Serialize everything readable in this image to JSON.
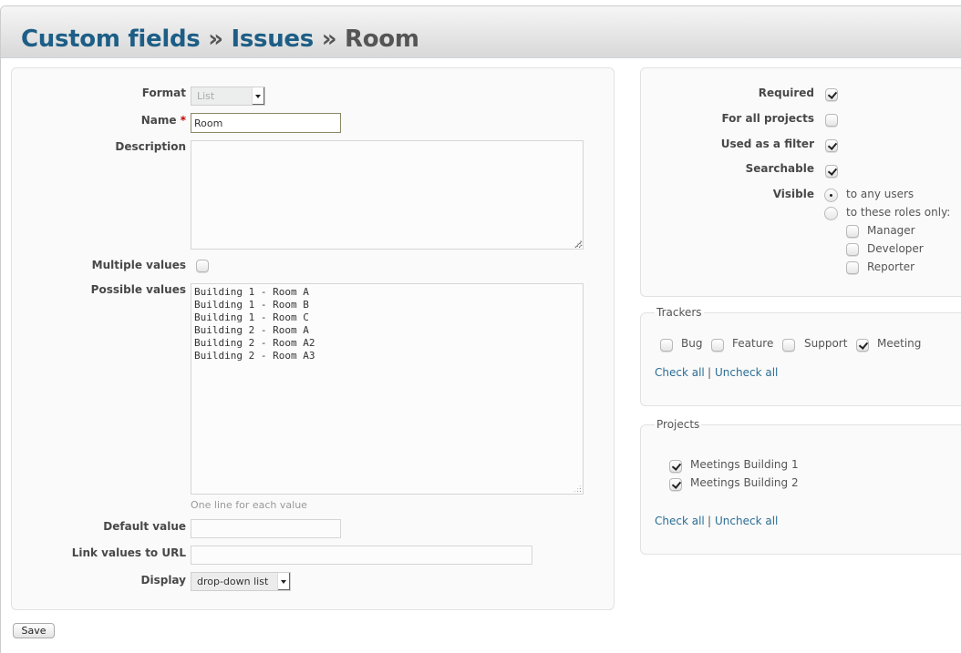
{
  "header": {
    "breadcrumb": [
      {
        "label": "Custom fields"
      },
      {
        "label": "Issues"
      }
    ],
    "separator": "»",
    "current": "Room"
  },
  "form": {
    "format": {
      "label": "Format",
      "value": "List"
    },
    "name": {
      "label": "Name",
      "required_mark": "*",
      "value": "Room"
    },
    "description": {
      "label": "Description",
      "value": ""
    },
    "multiple_values": {
      "label": "Multiple values",
      "checked": false
    },
    "possible_values": {
      "label": "Possible values",
      "value": "Building 1 - Room A\nBuilding 1 - Room B\nBuilding 1 - Room C\nBuilding 2 - Room A\nBuilding 2 - Room A2\nBuilding 2 - Room A3",
      "hint": "One line for each value"
    },
    "default_value": {
      "label": "Default value",
      "value": ""
    },
    "link_url": {
      "label": "Link values to URL",
      "value": ""
    },
    "display": {
      "label": "Display",
      "value": "drop-down list"
    }
  },
  "options": {
    "required": {
      "label": "Required",
      "checked": true
    },
    "for_all_projects": {
      "label": "For all projects",
      "checked": false
    },
    "used_as_filter": {
      "label": "Used as a filter",
      "checked": true
    },
    "searchable": {
      "label": "Searchable",
      "checked": true
    },
    "visible": {
      "label": "Visible",
      "any_users": "to any users",
      "these_roles": "to these roles only:",
      "selected": "any_users",
      "roles": [
        {
          "label": "Manager",
          "checked": false
        },
        {
          "label": "Developer",
          "checked": false
        },
        {
          "label": "Reporter",
          "checked": false
        }
      ]
    }
  },
  "trackers": {
    "legend": "Trackers",
    "items": [
      {
        "label": "Bug",
        "checked": false
      },
      {
        "label": "Feature",
        "checked": false
      },
      {
        "label": "Support",
        "checked": false
      },
      {
        "label": "Meeting",
        "checked": true
      }
    ],
    "check_all": "Check all",
    "uncheck_all": "Uncheck all",
    "divider": "|"
  },
  "projects": {
    "legend": "Projects",
    "items": [
      {
        "label": "Meetings Building 1",
        "checked": true
      },
      {
        "label": "Meetings Building 2",
        "checked": true
      }
    ],
    "check_all": "Check all",
    "uncheck_all": "Uncheck all",
    "divider": "|"
  },
  "actions": {
    "save_label": "Save"
  }
}
